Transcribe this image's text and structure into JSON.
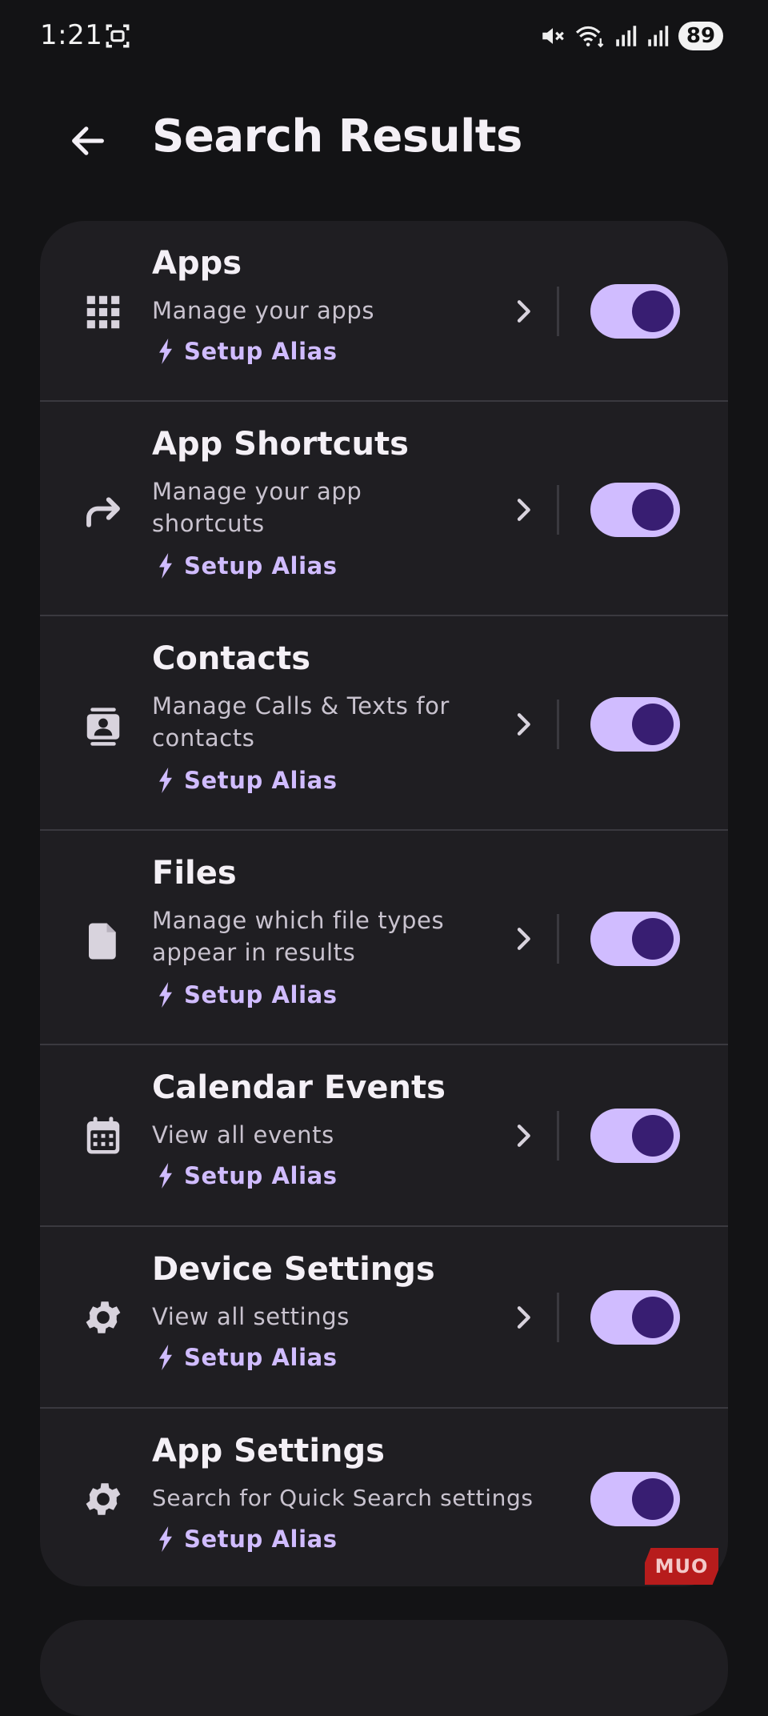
{
  "status_bar": {
    "time": "1:21",
    "battery": "89",
    "icons": [
      "screen-record-icon",
      "mute-icon",
      "wifi-icon",
      "signal-icon",
      "signal-icon"
    ]
  },
  "header": {
    "title": "Search Results",
    "back_icon": "arrow-back-icon"
  },
  "colors": {
    "background": "#131315",
    "card": "#1F1E22",
    "accent": "#D0BCFF",
    "toggle_knob": "#381E72"
  },
  "items": [
    {
      "title": "Apps",
      "subtitle": "Manage your apps",
      "alias": "Setup Alias",
      "icon": "apps-grid-icon",
      "enabled": true,
      "has_chevron": true
    },
    {
      "title": "App Shortcuts",
      "subtitle": "Manage your app shortcuts",
      "alias": "Setup Alias",
      "icon": "shortcut-arrow-icon",
      "enabled": true,
      "has_chevron": true
    },
    {
      "title": "Contacts",
      "subtitle": "Manage Calls & Texts for contacts",
      "alias": "Setup Alias",
      "icon": "contact-card-icon",
      "enabled": true,
      "has_chevron": true
    },
    {
      "title": "Files",
      "subtitle": "Manage which file types appear in results",
      "alias": "Setup Alias",
      "icon": "file-icon",
      "enabled": true,
      "has_chevron": true
    },
    {
      "title": "Calendar Events",
      "subtitle": "View all events",
      "alias": "Setup Alias",
      "icon": "calendar-icon",
      "enabled": true,
      "has_chevron": true
    },
    {
      "title": "Device Settings",
      "subtitle": "View all settings",
      "alias": "Setup Alias",
      "icon": "gear-icon",
      "enabled": true,
      "has_chevron": true
    },
    {
      "title": "App Settings",
      "subtitle": "Search for Quick Search settings",
      "alias": "Setup Alias",
      "icon": "gear-icon",
      "enabled": true,
      "has_chevron": false
    }
  ],
  "watermark": "MUO"
}
